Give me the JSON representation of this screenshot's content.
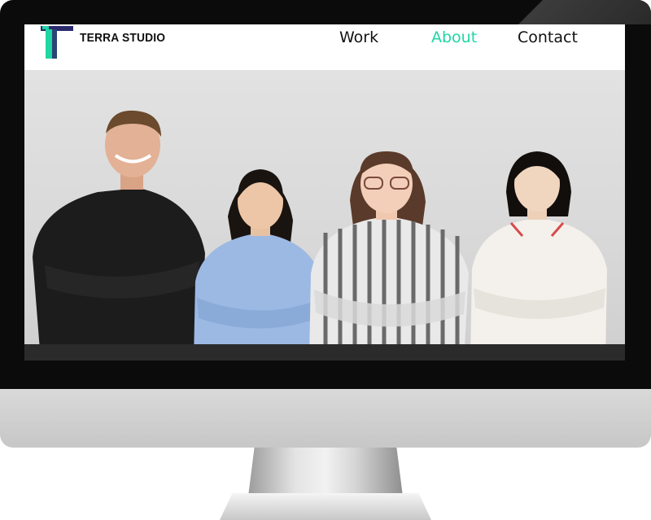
{
  "brand": {
    "name": "TERRA STUDIO",
    "logo_letter": "T",
    "colors": {
      "accent": "#1fd6a4",
      "dark": "#2b2a6e"
    }
  },
  "nav": {
    "items": [
      {
        "label": "Work",
        "active": false
      },
      {
        "label": "About",
        "active": true
      },
      {
        "label": "Contact",
        "active": false
      }
    ]
  },
  "hero": {
    "image": "team-photo"
  }
}
